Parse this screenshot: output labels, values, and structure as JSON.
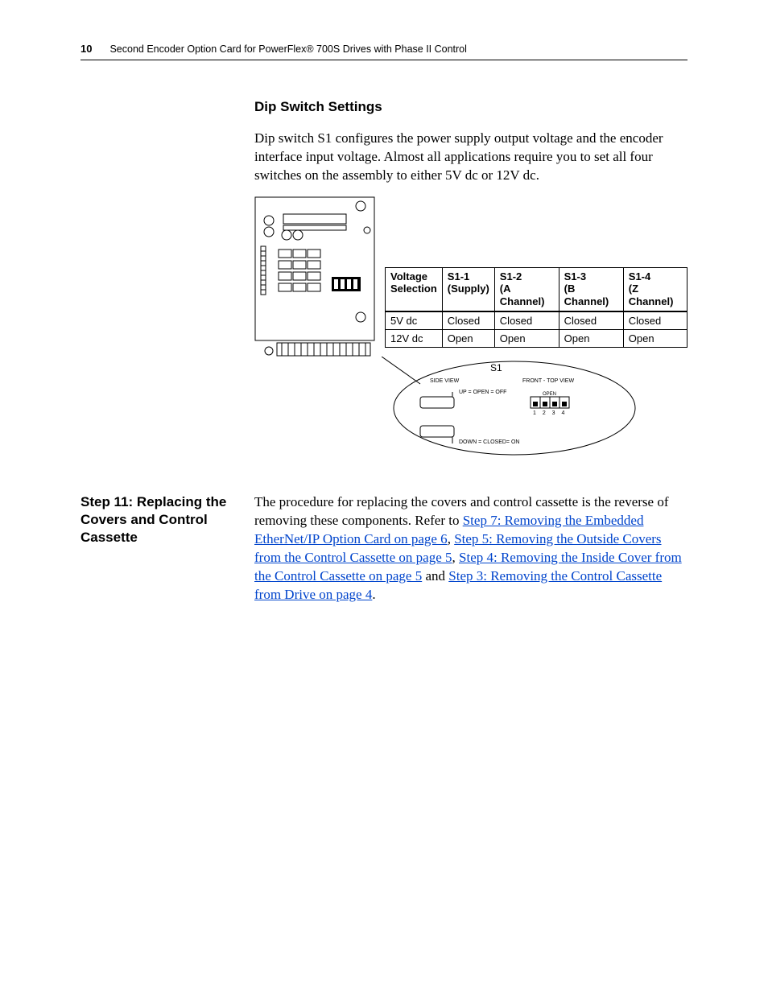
{
  "header": {
    "page_number": "10",
    "running_title": "Second Encoder Option Card for PowerFlex® 700S Drives with Phase II Control"
  },
  "dip": {
    "heading": "Dip Switch Settings",
    "para": "Dip switch S1 configures the power supply output voltage and the encoder interface input voltage. Almost all applications require you to set all four switches on the assembly to either 5V dc or 12V dc.",
    "table": {
      "headers": {
        "c0a": "Voltage",
        "c0b": "Selection",
        "c1a": "S1-1",
        "c1b": "(Supply)",
        "c2a": "S1-2",
        "c2b": "(A Channel)",
        "c3a": "S1-3",
        "c3b": "(B Channel)",
        "c4a": "S1-4",
        "c4b": "(Z Channel)"
      },
      "rows": [
        {
          "voltage": "5V dc",
          "s1": "Closed",
          "s2": "Closed",
          "s3": "Closed",
          "s4": "Closed"
        },
        {
          "voltage": "12V dc",
          "s1": "Open",
          "s2": "Open",
          "s3": "Open",
          "s4": "Open"
        }
      ]
    },
    "callout": {
      "title": "S1",
      "side_view": "SIDE VIEW",
      "front_view": "FRONT - TOP VIEW",
      "up_label": "UP = OPEN = OFF",
      "down_label": "DOWN = CLOSED= ON",
      "open_label": "OPEN",
      "positions": "1 2 3 4"
    }
  },
  "step11": {
    "heading": "Step 11: Replacing the Covers and Control Cassette",
    "intro": "The procedure for replacing the covers and control cassette is the reverse of removing these components. Refer to ",
    "link1": "Step 7: Removing the Embedded EtherNet/IP Option Card on page 6",
    "sep1": ", ",
    "link2": "Step 5: Removing the Outside Covers from the Control Cassette on page 5",
    "sep2": ", ",
    "link3": "Step 4: Removing the Inside Cover from the Control Cassette on page 5",
    "sep3": " and ",
    "link4": "Step 3: Removing the Control Cassette from Drive on page 4",
    "outro": "."
  }
}
